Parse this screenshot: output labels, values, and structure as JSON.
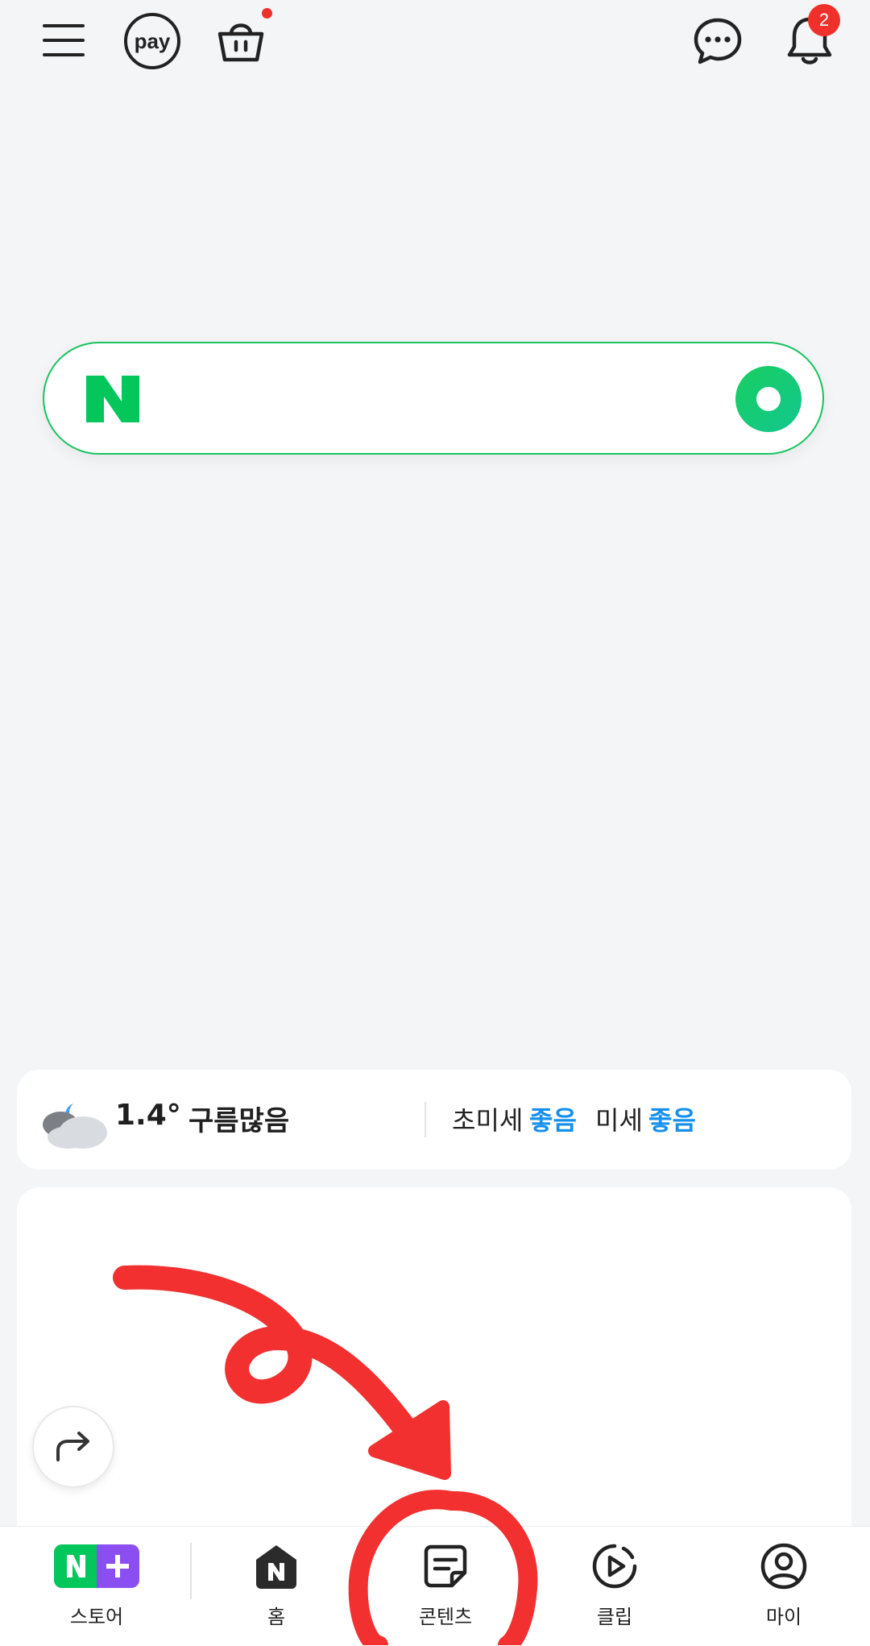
{
  "header": {
    "menu_icon": "hamburger-icon",
    "pay_label": "pay",
    "cart_icon": "shopping-bag-icon",
    "chat_icon": "chat-bubble-icon",
    "notification_icon": "bell-icon",
    "notification_count": "2"
  },
  "search": {
    "logo": "N",
    "placeholder": "",
    "button_icon": "green-dot-search-icon"
  },
  "weather": {
    "icon": "cloudy-night-icon",
    "temperature": "1.4°",
    "condition": "구름많음",
    "fine_dust_label": "초미세",
    "fine_dust_value": "좋음",
    "dust_label": "미세",
    "dust_value": "좋음"
  },
  "content_card": {
    "share_icon": "share-arrow-icon"
  },
  "bottom_nav": {
    "items": [
      {
        "label": "스토어",
        "icon": "n-plus-store-icon"
      },
      {
        "label": "홈",
        "icon": "n-home-icon"
      },
      {
        "label": "콘텐츠",
        "icon": "content-note-icon"
      },
      {
        "label": "클립",
        "icon": "clip-play-icon"
      },
      {
        "label": "마이",
        "icon": "profile-icon"
      }
    ]
  },
  "colors": {
    "naver_green": "#03c75a",
    "badge_red": "#f0312b",
    "dust_good_blue": "#1590ec",
    "annotation_red": "#f23030"
  }
}
